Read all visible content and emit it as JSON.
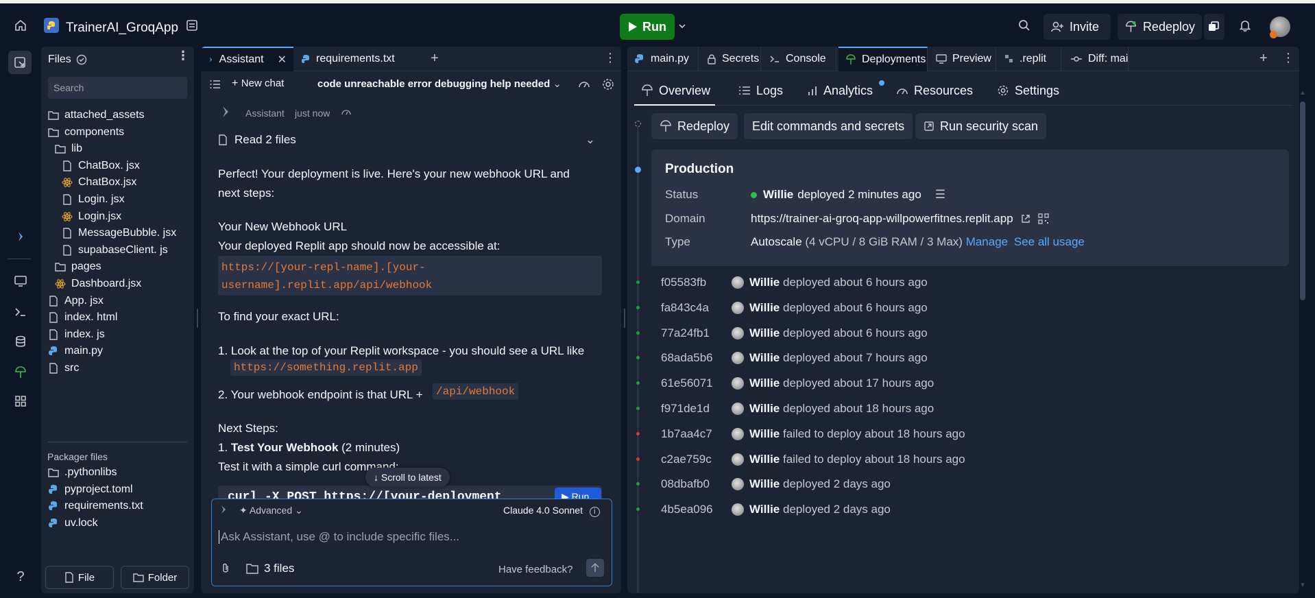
{
  "topbar": {
    "app_name": "TrainerAI_GroqApp",
    "run_label": "Run",
    "invite_label": "Invite",
    "redeploy_label": "Redeploy"
  },
  "files": {
    "title": "Files",
    "search_placeholder": "Search",
    "tree": [
      {
        "label": "attached_assets",
        "type": "folder"
      },
      {
        "label": "components",
        "type": "folder"
      },
      {
        "label": "lib",
        "type": "folder"
      },
      {
        "label": "ChatBox. jsx",
        "type": "file"
      },
      {
        "label": "ChatBox.jsx",
        "type": "react"
      },
      {
        "label": "Login. jsx",
        "type": "file"
      },
      {
        "label": "Login.jsx",
        "type": "react"
      },
      {
        "label": "MessageBubble. jsx",
        "type": "file"
      },
      {
        "label": "supabaseClient. js",
        "type": "file"
      },
      {
        "label": "pages",
        "type": "folder"
      },
      {
        "label": "Dashboard.jsx",
        "type": "react"
      },
      {
        "label": "App. jsx",
        "type": "file"
      },
      {
        "label": "index. html",
        "type": "file"
      },
      {
        "label": "index. js",
        "type": "file"
      },
      {
        "label": "main.py",
        "type": "python"
      },
      {
        "label": "src",
        "type": "file"
      }
    ],
    "packager_title": "Packager files",
    "packager": [
      {
        "label": ".pythonlibs",
        "type": "folder"
      },
      {
        "label": "pyproject.toml",
        "type": "python"
      },
      {
        "label": "requirements.txt",
        "type": "python"
      },
      {
        "label": "uv.lock",
        "type": "python"
      }
    ],
    "file_btn": "File",
    "folder_btn": "Folder"
  },
  "assistant": {
    "tabs": [
      "Assistant",
      "requirements.txt"
    ],
    "new_chat": "New chat",
    "chat_title": "code unreachable error debugging help needed",
    "author": "Assistant",
    "time": "just now",
    "read_files": "Read 2 files",
    "p1a": "Perfect! Your deployment is live. Here's your new webhook URL and",
    "p1b": "next steps:",
    "h1": "Your New Webhook URL",
    "p2": "Your deployed Replit app should now be accessible at:",
    "code1a": "https://[your-repl-name].[your-",
    "code1b": "username].replit.app/api/webhook",
    "p3": "To find your exact URL:",
    "li1": "1. Look at the top of your Replit workspace - you should see a URL like",
    "li1_code": "https://something.replit.app",
    "li2": "2. Your webhook endpoint is that URL +",
    "li2_code": "/api/webhook",
    "h2": "Next Steps:",
    "step1_num": "1.",
    "step1_bold": "Test Your Webhook",
    "step1_rest": "(2 minutes)",
    "p4": "Test it with a simple curl command:",
    "code2": "curl -X POST https://[your-deployment",
    "run_code": "Run",
    "scroll_latest": "Scroll to latest",
    "advanced": "Advanced",
    "model": "Claude 4.0 Sonnet",
    "input_placeholder": "Ask Assistant, use @ to include specific files...",
    "files_count": "3 files",
    "feedback": "Have feedback?"
  },
  "right": {
    "tabs": [
      "main.py",
      "Secrets",
      "Console",
      "Deployments",
      "Preview",
      ".replit",
      "Diff: main.p"
    ],
    "subtabs": [
      "Overview",
      "Logs",
      "Analytics",
      "Resources",
      "Settings"
    ],
    "actions": [
      "Redeploy",
      "Edit commands and secrets",
      "Run security scan"
    ],
    "production": {
      "title": "Production",
      "status_label": "Status",
      "status_user": "Willie",
      "status_text": "deployed 2 minutes ago",
      "domain_label": "Domain",
      "domain": "https://trainer-ai-groq-app-willpowerfitnes.replit.app",
      "type_label": "Type",
      "type_value": "Autoscale",
      "type_detail": "(4 vCPU / 8 GiB RAM / 3 Max)",
      "manage": "Manage",
      "see_usage": "See all usage"
    },
    "deployments": [
      {
        "hash": "f05583fb",
        "user": "Willie",
        "text": "deployed about 6 hours ago",
        "status": "ok"
      },
      {
        "hash": "fa843c4a",
        "user": "Willie",
        "text": "deployed about 6 hours ago",
        "status": "ok"
      },
      {
        "hash": "77a24fb1",
        "user": "Willie",
        "text": "deployed about 6 hours ago",
        "status": "ok"
      },
      {
        "hash": "68ada5b6",
        "user": "Willie",
        "text": "deployed about 7 hours ago",
        "status": "ok"
      },
      {
        "hash": "61e56071",
        "user": "Willie",
        "text": "deployed about 17 hours ago",
        "status": "ok"
      },
      {
        "hash": "f971de1d",
        "user": "Willie",
        "text": "deployed about 18 hours ago",
        "status": "ok"
      },
      {
        "hash": "1b7aa4c7",
        "user": "Willie",
        "text": "failed to deploy about 18 hours ago",
        "status": "fail"
      },
      {
        "hash": "c2ae759c",
        "user": "Willie",
        "text": "failed to deploy about 18 hours ago",
        "status": "fail"
      },
      {
        "hash": "08dbafb0",
        "user": "Willie",
        "text": "deployed 2 days ago",
        "status": "ok"
      },
      {
        "hash": "4b5ea096",
        "user": "Willie",
        "text": "deployed 2 days ago",
        "status": "ok"
      }
    ]
  },
  "colors": {
    "bg": "#0e1525",
    "panel": "#1c2333",
    "accent": "#57abff",
    "run_green": "#0f7b1a",
    "code_orange": "#e07b3a",
    "ok_dot": "#1f9d3c",
    "fail_dot": "#d63a3a"
  }
}
